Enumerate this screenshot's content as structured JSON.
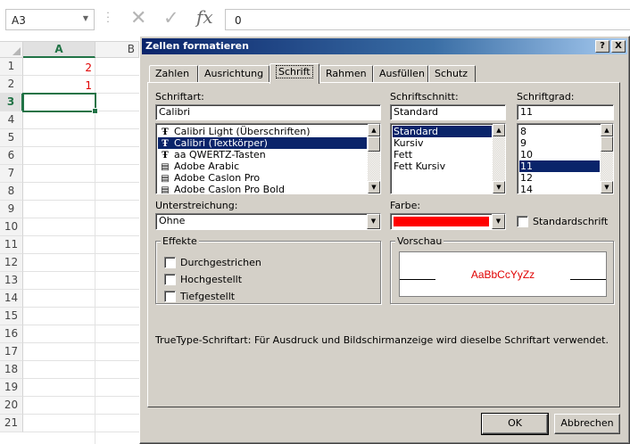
{
  "excel": {
    "namebox": "A3",
    "formula_value": "0",
    "columns": [
      "A",
      "B"
    ],
    "rows": [
      "1",
      "2",
      "3",
      "4",
      "5",
      "6",
      "7",
      "8",
      "9",
      "10",
      "11",
      "12",
      "13",
      "14",
      "15",
      "16",
      "17",
      "18",
      "19",
      "20",
      "21"
    ],
    "cells": [
      {
        "ref": "A1",
        "value": "2"
      },
      {
        "ref": "A2",
        "value": "1"
      }
    ],
    "value_color": "#e00000",
    "accent_color": "#217346",
    "icons": {
      "cancel": "cross-icon",
      "enter": "checkmark-icon",
      "function": "fx-icon"
    }
  },
  "dialog": {
    "title": "Zellen formatieren",
    "title_buttons": {
      "help": "?",
      "close": "X"
    },
    "tabs": [
      "Zahlen",
      "Ausrichtung",
      "Schrift",
      "Rahmen",
      "Ausfüllen",
      "Schutz"
    ],
    "active_tab": "Schrift",
    "font": {
      "label": "Schriftart:",
      "value": "Calibri",
      "items": [
        {
          "label": "Calibri Light (Überschriften)",
          "icon": "truetype-icon"
        },
        {
          "label": "Calibri (Textkörper)",
          "icon": "truetype-icon",
          "selected": true
        },
        {
          "label": "aa QWERTZ-Tasten",
          "icon": "truetype-icon"
        },
        {
          "label": "Adobe Arabic",
          "icon": "printer-font-icon"
        },
        {
          "label": "Adobe Caslon Pro",
          "icon": "printer-font-icon"
        },
        {
          "label": "Adobe Caslon Pro Bold",
          "icon": "printer-font-icon"
        }
      ]
    },
    "style": {
      "label": "Schriftschnitt:",
      "value": "Standard",
      "items": [
        {
          "label": "Standard",
          "selected": true
        },
        {
          "label": "Kursiv"
        },
        {
          "label": "Fett"
        },
        {
          "label": "Fett Kursiv"
        }
      ]
    },
    "size": {
      "label": "Schriftgrad:",
      "value": "11",
      "items": [
        {
          "label": "8"
        },
        {
          "label": "9"
        },
        {
          "label": "10"
        },
        {
          "label": "11",
          "selected": true
        },
        {
          "label": "12"
        },
        {
          "label": "14"
        }
      ]
    },
    "underline": {
      "label": "Unterstreichung:",
      "value": "Ohne"
    },
    "color": {
      "label": "Farbe:",
      "value": "#ff0000"
    },
    "standard_font": {
      "label": "Standardschrift",
      "checked": false
    },
    "effects": {
      "title": "Effekte",
      "items": [
        {
          "label": "Durchgestrichen",
          "checked": false
        },
        {
          "label": "Hochgestellt",
          "checked": false
        },
        {
          "label": "Tiefgestellt",
          "checked": false
        }
      ]
    },
    "preview": {
      "title": "Vorschau",
      "text": "AaBbCcYyZz",
      "color": "#e00000"
    },
    "info": "TrueType-Schriftart: Für Ausdruck und Bildschirmanzeige wird dieselbe Schriftart verwendet.",
    "buttons": {
      "ok": "OK",
      "cancel": "Abbrechen"
    }
  }
}
